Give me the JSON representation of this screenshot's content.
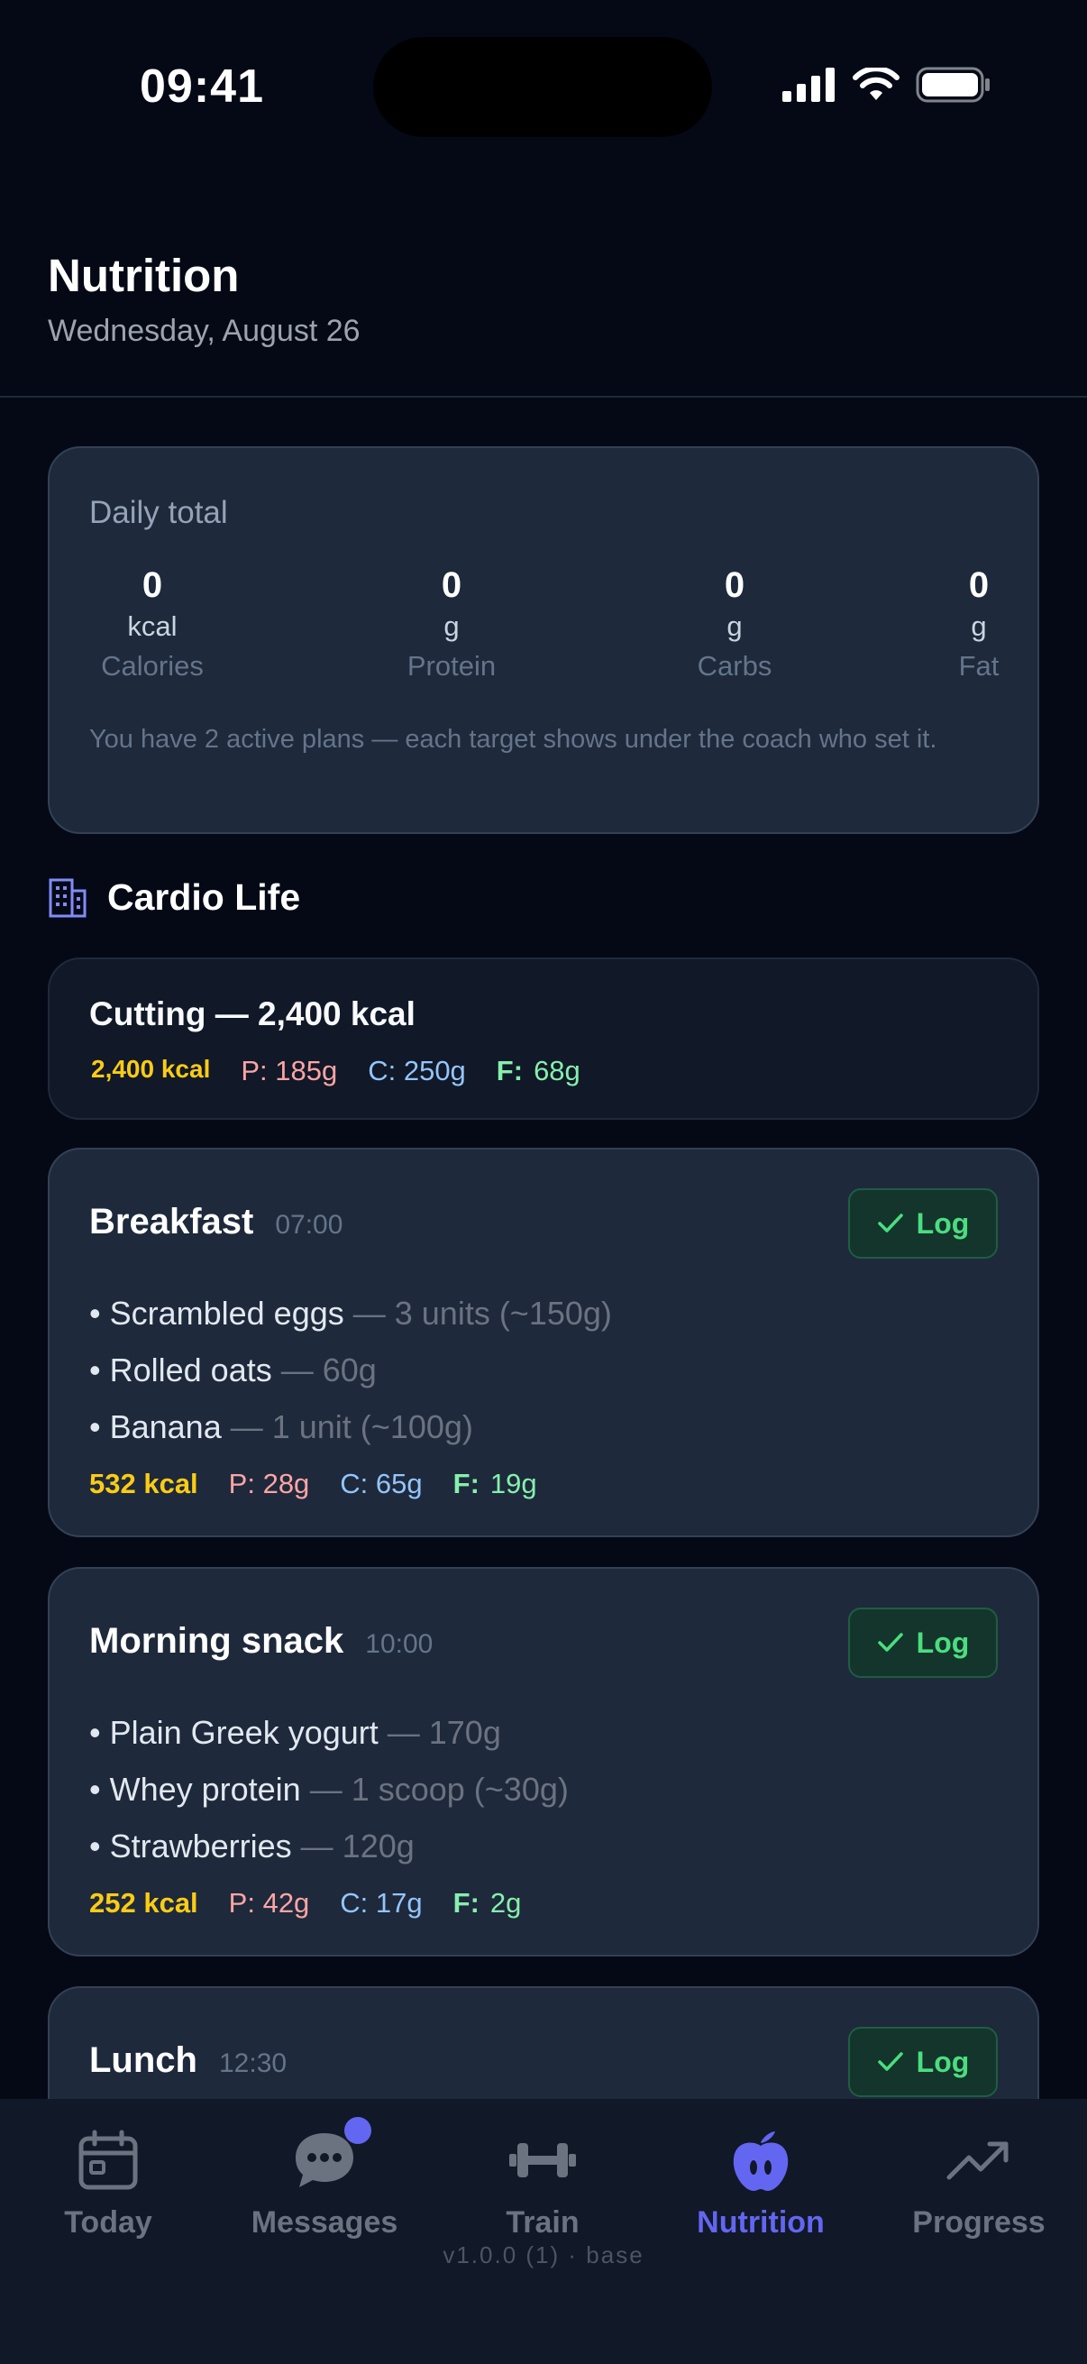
{
  "status": {
    "time": "09:41"
  },
  "header": {
    "title": "Nutrition",
    "date": "Wednesday, August 26"
  },
  "totals": {
    "label": "Daily total",
    "macros": [
      {
        "value": "0",
        "unit": "kcal",
        "name": "Calories"
      },
      {
        "value": "0",
        "unit": "g",
        "name": "Protein"
      },
      {
        "value": "0",
        "unit": "g",
        "name": "Carbs"
      },
      {
        "value": "0",
        "unit": "g",
        "name": "Fat"
      }
    ],
    "note": "You have 2 active plans — each target shows under the coach who set it."
  },
  "coach": {
    "name": "Cardio Life",
    "icon": "building-icon"
  },
  "plan": {
    "title": "Cutting — 2,400 kcal",
    "kcal": "2,400 kcal",
    "protein": "P: 185g",
    "carbs": "C: 250g",
    "fat_label": "F:",
    "fat_value": "68g"
  },
  "meals": [
    {
      "name": "Breakfast",
      "time": "07:00",
      "log_label": "Log",
      "items": [
        {
          "name": "• Scrambled eggs",
          "qty": " — 3 units (~150g)"
        },
        {
          "name": "• Rolled oats",
          "qty": " — 60g"
        },
        {
          "name": "• Banana",
          "qty": " — 1 unit (~100g)"
        }
      ],
      "kcal": "532 kcal",
      "protein": "P: 28g",
      "carbs": "C: 65g",
      "fat_label": "F:",
      "fat_value": "19g"
    },
    {
      "name": "Morning snack",
      "time": "10:00",
      "log_label": "Log",
      "items": [
        {
          "name": "• Plain Greek yogurt",
          "qty": " — 170g"
        },
        {
          "name": "• Whey protein",
          "qty": " — 1 scoop (~30g)"
        },
        {
          "name": "• Strawberries",
          "qty": " — 120g"
        }
      ],
      "kcal": "252 kcal",
      "protein": "P: 42g",
      "carbs": "C: 17g",
      "fat_label": "F:",
      "fat_value": "2g"
    },
    {
      "name": "Lunch",
      "time": "12:30",
      "log_label": "Log"
    }
  ],
  "nav": {
    "items": [
      {
        "label": "Today",
        "icon": "calendar-icon"
      },
      {
        "label": "Messages",
        "icon": "chat-icon"
      },
      {
        "label": "Train",
        "icon": "dumbbell-icon"
      },
      {
        "label": "Nutrition",
        "icon": "apple-icon"
      },
      {
        "label": "Progress",
        "icon": "trend-up-icon"
      }
    ],
    "active": "Nutrition",
    "version": "v1.0.0 (1) · base"
  },
  "colors": {
    "accent": "#6366f1",
    "log_green": "#4ade80",
    "kcal": "#facc15",
    "protein": "#fca5a5",
    "carbs": "#93c5fd",
    "fat": "#86efac"
  }
}
